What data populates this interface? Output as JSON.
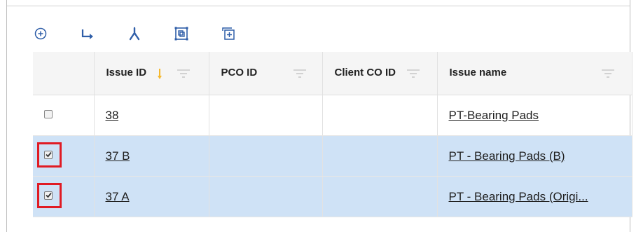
{
  "toolbar": {
    "buttons": [
      {
        "icon": "add-circle-icon"
      },
      {
        "icon": "child-arrow-icon"
      },
      {
        "icon": "merge-icon"
      },
      {
        "icon": "group-icon"
      },
      {
        "icon": "expand-box-icon"
      }
    ],
    "accent": "#2f5ea8"
  },
  "table": {
    "columns": [
      {
        "label": ""
      },
      {
        "label": "Issue ID"
      },
      {
        "label": "PCO ID"
      },
      {
        "label": "Client CO ID"
      },
      {
        "label": "Issue name"
      }
    ],
    "rows": [
      {
        "checked": false,
        "issue_id": "38",
        "pco_id": "",
        "client_co_id": "",
        "issue_name": "PT-Bearing Pads"
      },
      {
        "checked": true,
        "issue_id": "37 B",
        "pco_id": "",
        "client_co_id": "",
        "issue_name": "PT - Bearing Pads (B)"
      },
      {
        "checked": true,
        "issue_id": "37 A",
        "pco_id": "",
        "client_co_id": "",
        "issue_name": "PT - Bearing Pads (Origi..."
      }
    ],
    "selected_row_color": "#cfe2f6",
    "highlight_color": "#e01b24"
  }
}
